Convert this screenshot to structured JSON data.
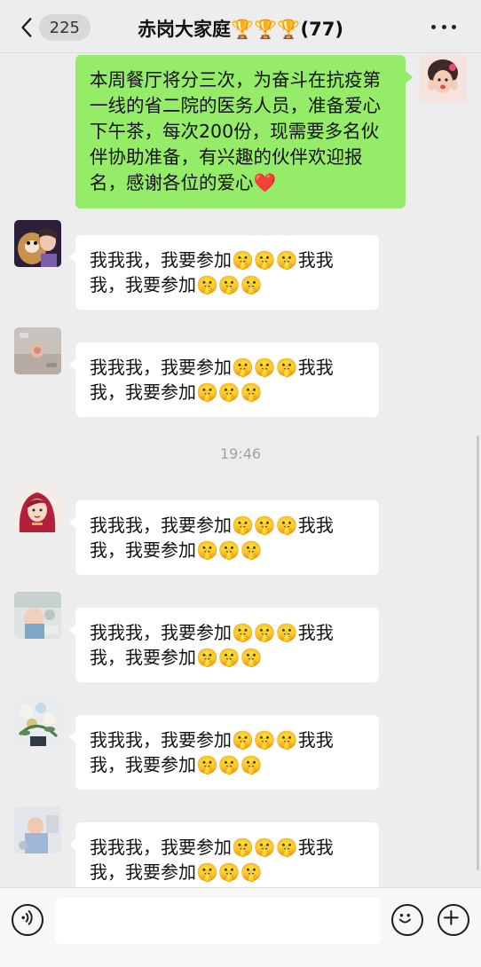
{
  "header": {
    "back_badge": "225",
    "title": "赤岗大家庭🏆🏆🏆(77)"
  },
  "messages": {
    "self_post": "本周餐厅将分三次，为奋斗在抗疫第一线的省二院的医务人员，准备爱心下午茶，每次200份，现需要多名伙伴协助准备，有兴趣的伙伴欢迎报名，感谢各位的爱心❤️",
    "reply_1": "我我我，我要参加🤫🤫🤫我我我，我要参加🤫🤫🤫",
    "reply_2": "我我我，我要参加🤫🤫🤫我我我，我要参加🤫🤫🤫",
    "timestamp": "19:46",
    "reply_3": "我我我，我要参加🤫🤫🤫我我我，我要参加🤫🤫🤫",
    "reply_4": "我我我，我要参加🤫🤫🤫我我我，我要参加🤫🤫🤫",
    "reply_5": "我我我，我要参加🤫🤫🤫我我我，我要参加🤫🤫🤫",
    "reply_6": "我我我，我要参加🤫🤫🤫我我我，我要参加🤫🤫🤫"
  },
  "input": {
    "placeholder": ""
  },
  "icons": {
    "back": "chevron-left-icon",
    "more": "more-dots-icon",
    "voice": "voice-icon",
    "emoji": "emoji-icon",
    "add": "plus-icon"
  },
  "colors": {
    "outgoing_bubble": "#95ec69",
    "incoming_bubble": "#ffffff",
    "background": "#ededed"
  }
}
